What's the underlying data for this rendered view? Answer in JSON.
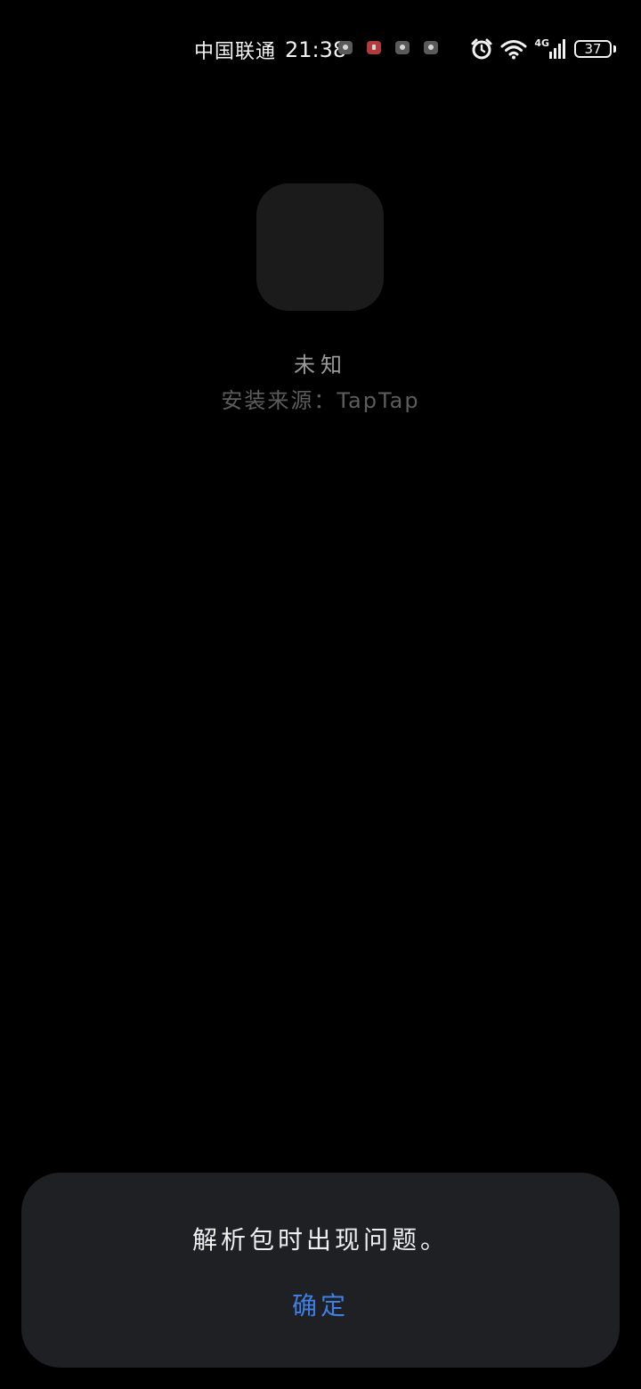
{
  "status_bar": {
    "carrier": "中国联通",
    "time": "21:38",
    "network": "4G",
    "battery": "37",
    "icons": [
      "notification-icon",
      "notification-icon",
      "notification-icon",
      "notification-icon",
      "alarm-icon",
      "wifi-icon",
      "signal-icon",
      "battery-icon"
    ]
  },
  "app": {
    "name": "未知",
    "install_source": "安装来源：TapTap"
  },
  "dialog": {
    "message": "解析包时出现问题。",
    "confirm_label": "确定"
  },
  "colors": {
    "background": "#000000",
    "dialog_background": "#1f2023",
    "accent": "#3f7fe6"
  }
}
